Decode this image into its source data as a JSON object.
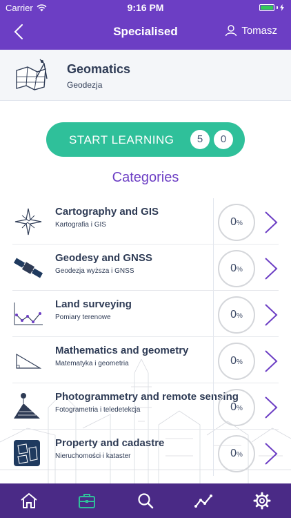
{
  "status_bar": {
    "carrier": "Carrier",
    "time": "9:16 PM"
  },
  "nav": {
    "title": "Specialised",
    "user_name": "Tomasz"
  },
  "course": {
    "title": "Geomatics",
    "subtitle": "Geodezja"
  },
  "start_button": {
    "label": "START LEARNING",
    "count_a": "5",
    "count_b": "0"
  },
  "categories_heading": "Categories",
  "categories": [
    {
      "title": "Cartography and GIS",
      "subtitle": "Kartografia i GIS",
      "progress": "0",
      "unit": "%",
      "icon": "compass-rose-icon"
    },
    {
      "title": "Geodesy and GNSS",
      "subtitle": "Geodezja wyższa i GNSS",
      "progress": "0",
      "unit": "%",
      "icon": "satellite-icon"
    },
    {
      "title": "Land surveying",
      "subtitle": "Pomiary terenowe",
      "progress": "0",
      "unit": "%",
      "icon": "survey-traverse-icon"
    },
    {
      "title": "Mathematics and geometry",
      "subtitle": "Matematyka i geometria",
      "progress": "0",
      "unit": "%",
      "icon": "triangle-icon"
    },
    {
      "title": "Photogrammetry and remote sensing",
      "subtitle": "Fotogrametria i teledetekcja",
      "progress": "0",
      "unit": "%",
      "icon": "aerial-camera-icon"
    },
    {
      "title": "Property and cadastre",
      "subtitle": "Nieruchomości i kataster",
      "progress": "0",
      "unit": "%",
      "icon": "cadastre-map-icon"
    }
  ],
  "tab_bar": [
    "home-icon",
    "briefcase-icon",
    "search-icon",
    "stats-icon",
    "settings-icon"
  ],
  "colors": {
    "header": "#6c3ec4",
    "tab_bar": "#4a2a86",
    "start_button": "#2fc09a",
    "accent": "#6c3ec4",
    "active_tab": "#2fc09a"
  }
}
